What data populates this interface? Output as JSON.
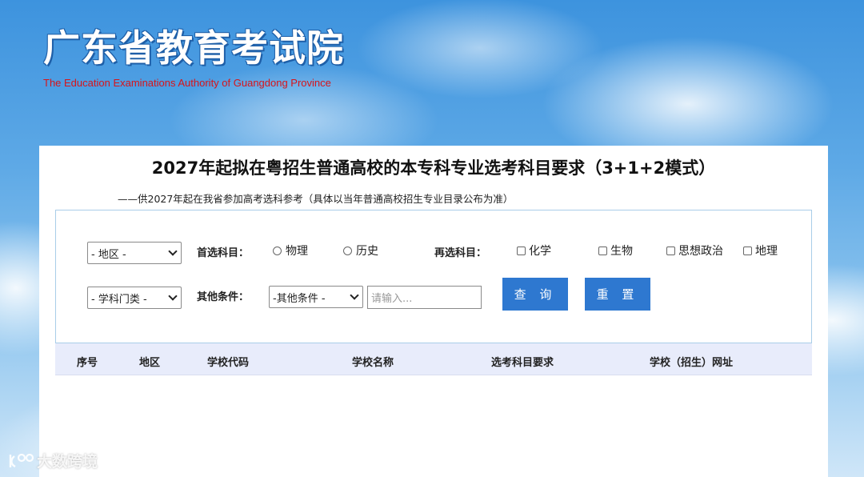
{
  "header": {
    "title": "广东省教育考试院",
    "subtitle": "The Education Examinations Authority of Guangdong Province"
  },
  "main": {
    "title": "2027年起拟在粤招生普通高校的本专科专业选考科目要求（3+1+2模式）",
    "subtitle": "——供2027年起在我省参加高考选科参考（具体以当年普通高校招生专业目录公布为准）"
  },
  "filters": {
    "region_select": "- 地区 -",
    "category_select": "- 学科门类 -",
    "first_subject_label": "首选科目：",
    "first_subject_options": [
      "物理",
      "历史"
    ],
    "second_subject_label": "再选科目：",
    "second_subject_options": [
      "化学",
      "生物",
      "思想政治",
      "地理"
    ],
    "other_label": "其他条件：",
    "other_select": "-其他条件 -",
    "search_placeholder": "请输入...",
    "query_button": "查 询",
    "reset_button": "重 置"
  },
  "table": {
    "headers": [
      "序号",
      "地区",
      "学校代码",
      "学校名称",
      "选考科目要求",
      "学校（招生）网址"
    ]
  },
  "watermark": {
    "text": "大数跨境"
  },
  "colors": {
    "button": "#2e78d0",
    "table_header_bg": "#e8ecfb",
    "subtitle_red": "#d7141a"
  }
}
